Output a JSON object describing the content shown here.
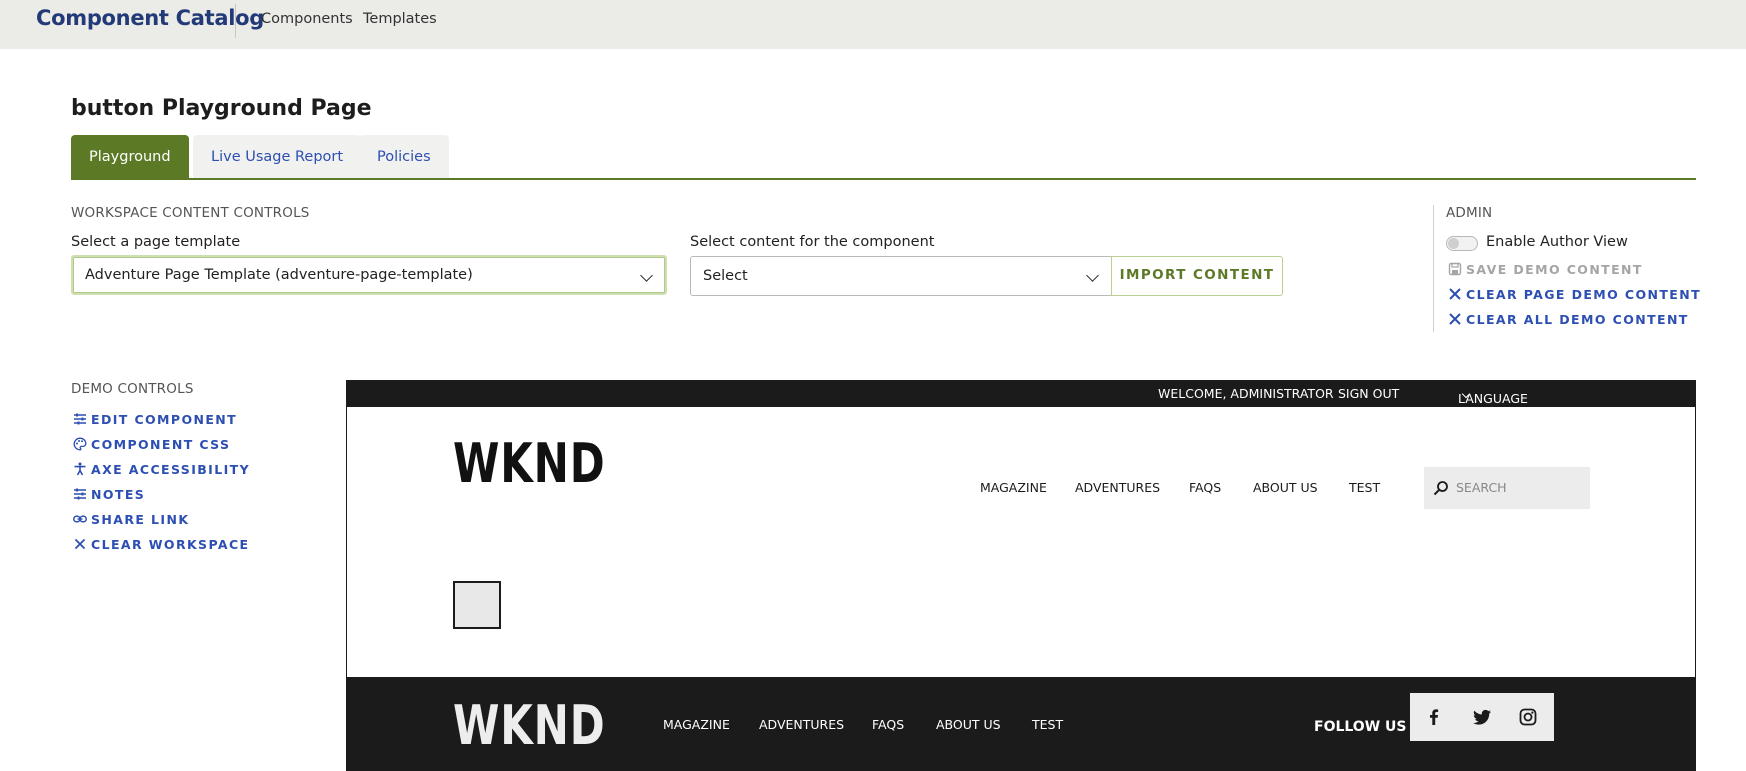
{
  "app": {
    "brand": "Component Catalog",
    "nav": {
      "components": "Components",
      "templates": "Templates"
    }
  },
  "page": {
    "title": "button Playground Page",
    "tabs": {
      "playground": "Playground",
      "usage": "Live Usage Report",
      "policies": "Policies"
    },
    "active_tab": "Playground"
  },
  "workspace": {
    "section_label": "WORKSPACE CONTENT CONTROLS",
    "template_label": "Select a page template",
    "template_value": "Adventure Page Template (adventure-page-template)",
    "content_label": "Select content for the component",
    "content_value": "Select",
    "import_button": "IMPORT CONTENT"
  },
  "admin": {
    "section_label": "ADMIN",
    "author_view_label": "Enable Author View",
    "author_view_enabled": false,
    "save_demo": "SAVE DEMO CONTENT",
    "clear_page_demo": "CLEAR PAGE DEMO CONTENT",
    "clear_all_demo": "CLEAR ALL DEMO CONTENT"
  },
  "demo": {
    "section_label": "DEMO CONTROLS",
    "edit_component": "EDIT COMPONENT",
    "component_css": "COMPONENT CSS",
    "axe": "AXE ACCESSIBILITY",
    "notes": "NOTES",
    "share_link": "SHARE LINK",
    "clear_workspace": "CLEAR WORKSPACE"
  },
  "preview": {
    "welcome": "WELCOME, ADMINISTRATOR",
    "sign_out": "SIGN OUT",
    "language": "LANGUAGE",
    "logo": "WKND",
    "nav": {
      "magazine": "MAGAZINE",
      "adventures": "ADVENTURES",
      "faqs": "FAQS",
      "about": "ABOUT US",
      "test": "TEST"
    },
    "search_placeholder": "SEARCH",
    "footer": {
      "logo": "WKND",
      "nav": {
        "magazine": "MAGAZINE",
        "adventures": "ADVENTURES",
        "faqs": "FAQS",
        "about": "ABOUT US",
        "test": "TEST"
      },
      "follow_us": "FOLLOW US",
      "social_icons": [
        "facebook-icon",
        "twitter-icon",
        "instagram-icon"
      ]
    }
  },
  "colors": {
    "accent_green": "#5c7a26",
    "link_blue": "#2d4fb2",
    "brand_navy": "#233a78",
    "dark": "#1b1b1b"
  }
}
